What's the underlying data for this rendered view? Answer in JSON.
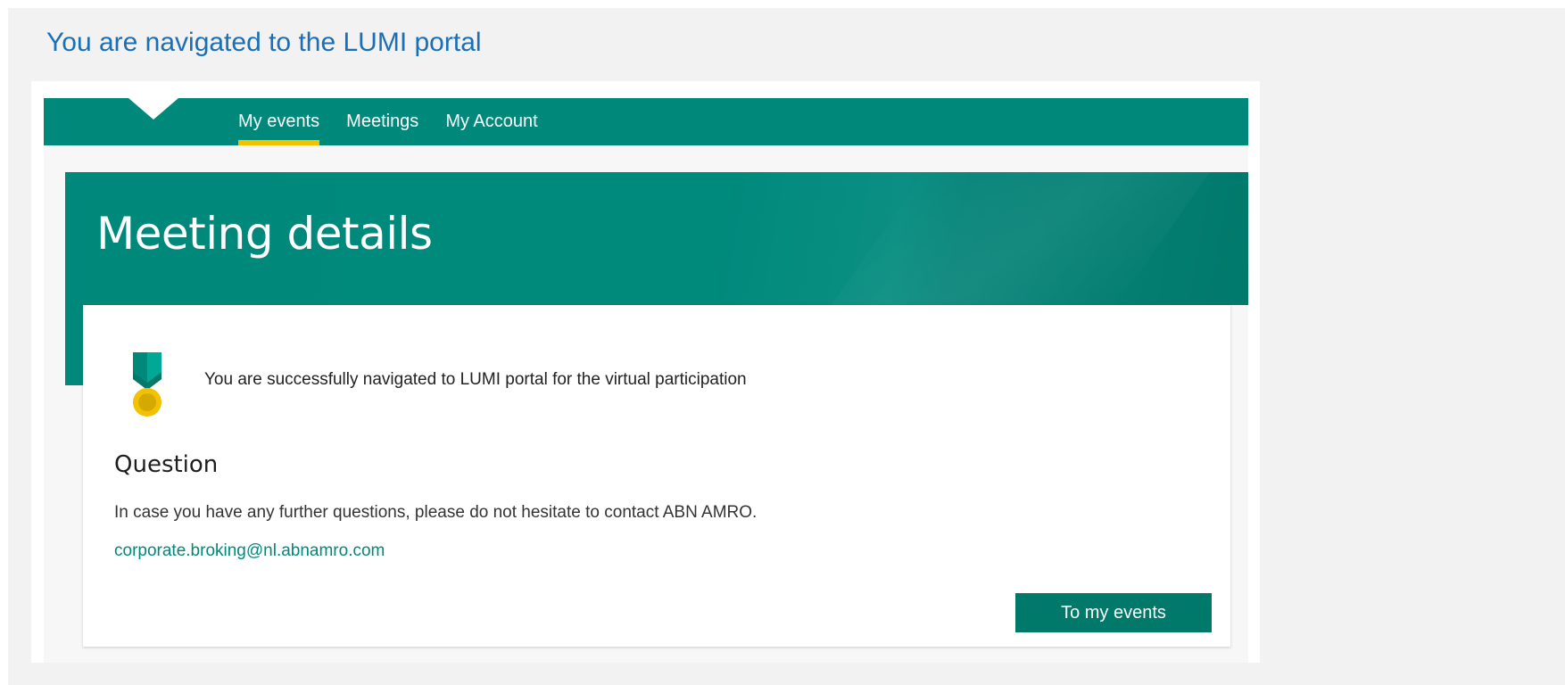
{
  "caption": "You are navigated to the LUMI portal",
  "nav": {
    "tabs": [
      {
        "label": "My events",
        "active": true
      },
      {
        "label": "Meetings",
        "active": false
      },
      {
        "label": "My Account",
        "active": false
      }
    ]
  },
  "hero": {
    "title": "Meeting details"
  },
  "card": {
    "icon": "medal-icon",
    "success_message": "You are successfully navigated to LUMI portal for the virtual participation",
    "question_heading": "Question",
    "question_text": "In case you have any further questions, please do not hesitate to contact ABN AMRO.",
    "email": "corporate.broking@nl.abnamro.com",
    "button_label": "To my events"
  },
  "colors": {
    "brand_teal": "#00897b",
    "button_teal": "#00796b",
    "active_underline": "#f2c200",
    "caption_blue": "#1a6fb5"
  }
}
